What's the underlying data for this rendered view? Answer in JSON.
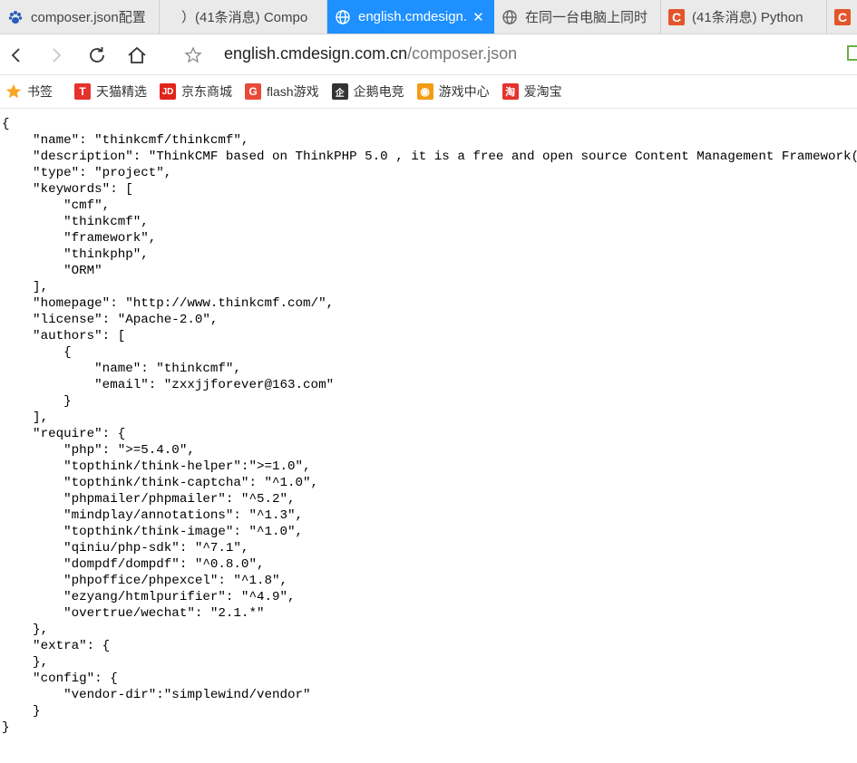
{
  "tabs": [
    {
      "label": "composer.json配置",
      "icon": "paw-icon",
      "active": false
    },
    {
      "label": "）(41条消息) Compo",
      "icon": "none",
      "active": false
    },
    {
      "label": "english.cmdesign.",
      "icon": "globe-icon",
      "active": true
    },
    {
      "label": "在同一台电脑上同时",
      "icon": "globe-icon",
      "active": false
    },
    {
      "label": "(41条消息) Python",
      "icon": "c-icon",
      "active": false
    },
    {
      "label": "",
      "icon": "c-icon",
      "active": false
    }
  ],
  "address": {
    "host": "english.cmdesign.com.cn",
    "path": "/composer.json"
  },
  "bookmarks": [
    {
      "label": "书签",
      "icon": "star-icon",
      "color": "#f5a623"
    },
    {
      "label": "天猫精选",
      "icon": "tmall-icon",
      "color": "#e5322d",
      "glyph": "T"
    },
    {
      "label": "京东商城",
      "icon": "jd-icon",
      "color": "#e1251b",
      "glyph": "JD"
    },
    {
      "label": "flash游戏",
      "icon": "flash-game-icon",
      "color": "#e84b3a",
      "glyph": "G"
    },
    {
      "label": "企鹅电竞",
      "icon": "penguin-icon",
      "color": "#333333",
      "glyph": "企"
    },
    {
      "label": "游戏中心",
      "icon": "gamepad-icon",
      "color": "#f39c12",
      "glyph": "◉"
    },
    {
      "label": "爱淘宝",
      "icon": "taobao-icon",
      "color": "#e5322d",
      "glyph": "淘"
    }
  ],
  "json_text": "{\n    \"name\": \"thinkcmf/thinkcmf\",\n    \"description\": \"ThinkCMF based on ThinkPHP 5.0 , it is a free and open source Content Management Framework(CMF)\",\n    \"type\": \"project\",\n    \"keywords\": [\n        \"cmf\",\n        \"thinkcmf\",\n        \"framework\",\n        \"thinkphp\",\n        \"ORM\"\n    ],\n    \"homepage\": \"http://www.thinkcmf.com/\",\n    \"license\": \"Apache-2.0\",\n    \"authors\": [\n        {\n            \"name\": \"thinkcmf\",\n            \"email\": \"zxxjjforever@163.com\"\n        }\n    ],\n    \"require\": {\n        \"php\": \">=5.4.0\",\n        \"topthink/think-helper\":\">=1.0\",\n        \"topthink/think-captcha\": \"^1.0\",\n        \"phpmailer/phpmailer\": \"^5.2\",\n        \"mindplay/annotations\": \"^1.3\",\n        \"topthink/think-image\": \"^1.0\",\n        \"qiniu/php-sdk\": \"^7.1\",\n        \"dompdf/dompdf\": \"^0.8.0\",\n        \"phpoffice/phpexcel\": \"^1.8\",\n        \"ezyang/htmlpurifier\": \"^4.9\",\n        \"overtrue/wechat\": \"2.1.*\"\n    },\n    \"extra\": {\n    },\n    \"config\": {\n        \"vendor-dir\":\"simplewind/vendor\"\n    }\n}"
}
